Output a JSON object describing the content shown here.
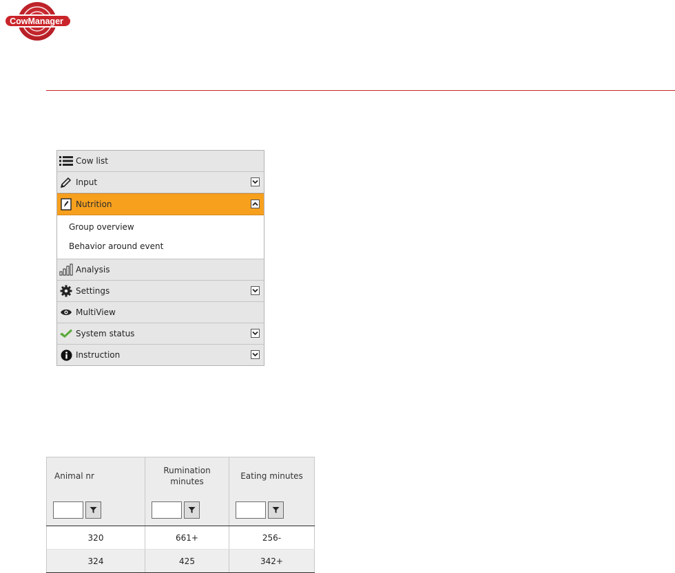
{
  "logo": {
    "text": "CowManager",
    "registered": "®"
  },
  "colors": {
    "brand_red": "#c9242a",
    "active_orange": "#f7a01e",
    "menu_bg": "#e6e6e6",
    "check_green": "#5aaa3c"
  },
  "nav": {
    "items": [
      {
        "label": "Cow list",
        "icon": "list-icon",
        "has_chevron": false
      },
      {
        "label": "Input",
        "icon": "pencil-icon",
        "has_chevron": true,
        "chevron": "down"
      },
      {
        "label": "Nutrition",
        "icon": "nutrition-icon",
        "has_chevron": true,
        "chevron": "up",
        "active": true
      },
      {
        "label": "Analysis",
        "icon": "bar-chart-icon",
        "has_chevron": false
      },
      {
        "label": "Settings",
        "icon": "gear-icon",
        "has_chevron": true,
        "chevron": "down"
      },
      {
        "label": "MultiView",
        "icon": "eye-icon",
        "has_chevron": false
      },
      {
        "label": "System status",
        "icon": "check-icon",
        "has_chevron": true,
        "chevron": "down"
      },
      {
        "label": "Instruction",
        "icon": "info-icon",
        "has_chevron": true,
        "chevron": "down"
      }
    ],
    "submenu": [
      {
        "label": "Group overview"
      },
      {
        "label": "Behavior around event"
      }
    ]
  },
  "table": {
    "columns": [
      "Animal nr",
      "Rumination minutes",
      "Eating minutes"
    ],
    "filters": [
      {
        "value": "",
        "icon": "filter-icon"
      },
      {
        "value": "",
        "icon": "filter-icon"
      },
      {
        "value": "",
        "icon": "filter-icon"
      }
    ],
    "rows": [
      [
        "320",
        "661+",
        "256-"
      ],
      [
        "324",
        "425",
        "342+"
      ]
    ]
  }
}
